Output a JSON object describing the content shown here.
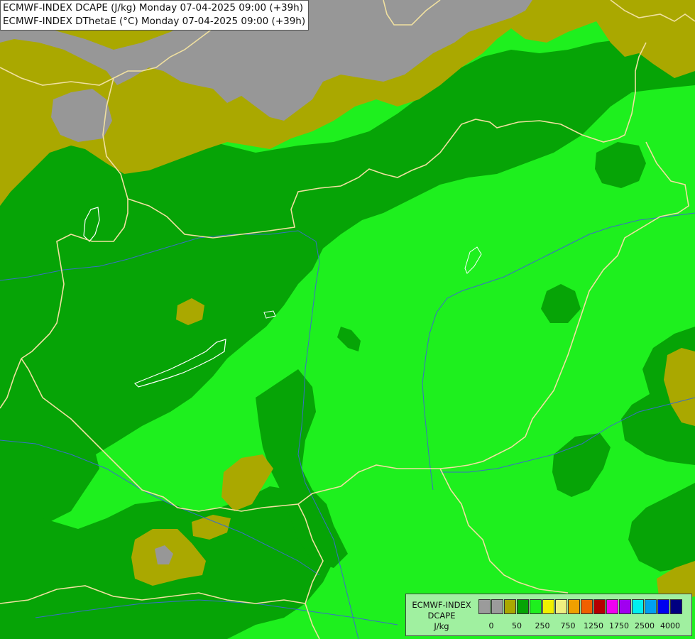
{
  "map": {
    "title_line1": "ECMWF-INDEX DCAPE (J/kg) Monday 07-04-2025 09:00 (+39h)",
    "title_line2": "ECMWF-INDEX DThetaE (°C) Monday 07-04-2025 09:00 (+39h)"
  },
  "colors": {
    "light_green": "#1ef01e",
    "dark_green": "#06a406",
    "olive": "#aaa800",
    "gray": "#979797",
    "border": "#f0e0a0",
    "river": "#3a6ec8",
    "lake_outline": "#ffffff"
  },
  "legend": {
    "name_line1": "ECMWF-INDEX",
    "name_line2": "DCAPE",
    "unit": "J/kg",
    "swatches": [
      {
        "color": "#9b9b9b"
      },
      {
        "color": "#9b9b9b"
      },
      {
        "color": "#aaa800"
      },
      {
        "color": "#06a406"
      },
      {
        "color": "#1ef01e"
      },
      {
        "color": "#f0f000"
      },
      {
        "color": "#f0f080"
      },
      {
        "color": "#f0a000"
      },
      {
        "color": "#f06000"
      },
      {
        "color": "#b40000"
      },
      {
        "color": "#f000f0"
      },
      {
        "color": "#a000f0"
      },
      {
        "color": "#00f0f0"
      },
      {
        "color": "#00a0f0"
      },
      {
        "color": "#0000f0"
      },
      {
        "color": "#000080"
      }
    ],
    "ticks": [
      "0",
      "50",
      "250",
      "750",
      "1250",
      "1750",
      "2500",
      "4000"
    ]
  }
}
